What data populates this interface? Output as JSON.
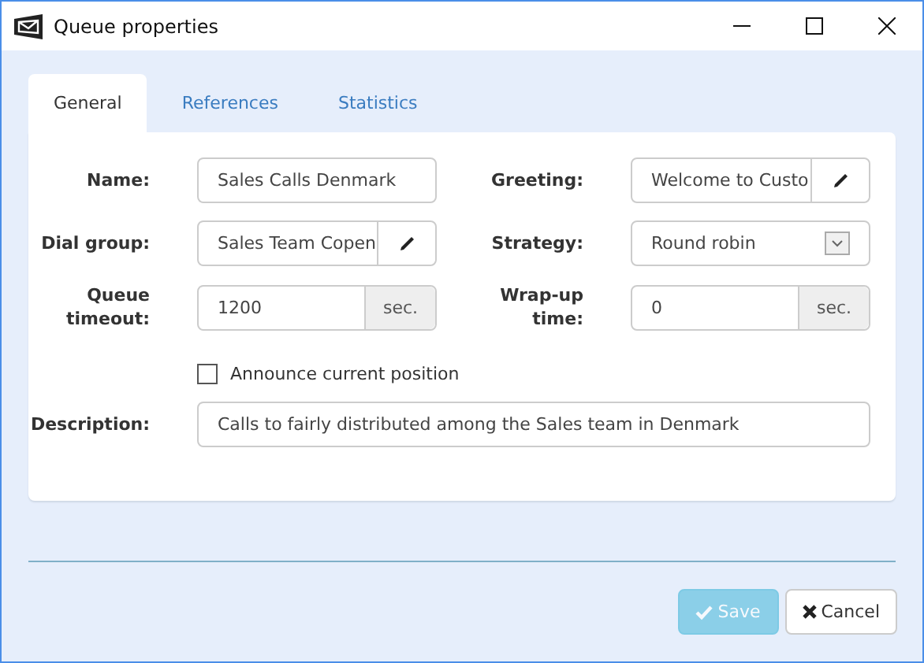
{
  "window": {
    "title": "Queue properties"
  },
  "tabs": [
    {
      "label": "General",
      "selected": true
    },
    {
      "label": "References",
      "selected": false
    },
    {
      "label": "Statistics",
      "selected": false
    }
  ],
  "fields": [
    {
      "label": "Name:",
      "kind": "text",
      "value": "Sales Calls Denmark"
    },
    {
      "label": "Greeting:",
      "kind": "edit",
      "value": "Welcome to Custo"
    },
    {
      "label": "Dial group:",
      "kind": "edit",
      "value": "Sales Team Copen"
    },
    {
      "label": "Strategy:",
      "kind": "select",
      "value": "Round robin"
    },
    {
      "label": "Queue timeout:",
      "kind": "unit",
      "value": "1200",
      "unit": "sec."
    },
    {
      "label": "Wrap-up time:",
      "kind": "unit",
      "value": "0",
      "unit": "sec."
    }
  ],
  "announce": {
    "label": "Announce current position",
    "checked": false
  },
  "description": {
    "label": "Description:",
    "value": "Calls to fairly distributed among the Sales team in Denmark"
  },
  "buttons": [
    {
      "label": "Save",
      "kind": "save",
      "disabled": true
    },
    {
      "label": "Cancel",
      "kind": "cancel",
      "disabled": false
    }
  ]
}
